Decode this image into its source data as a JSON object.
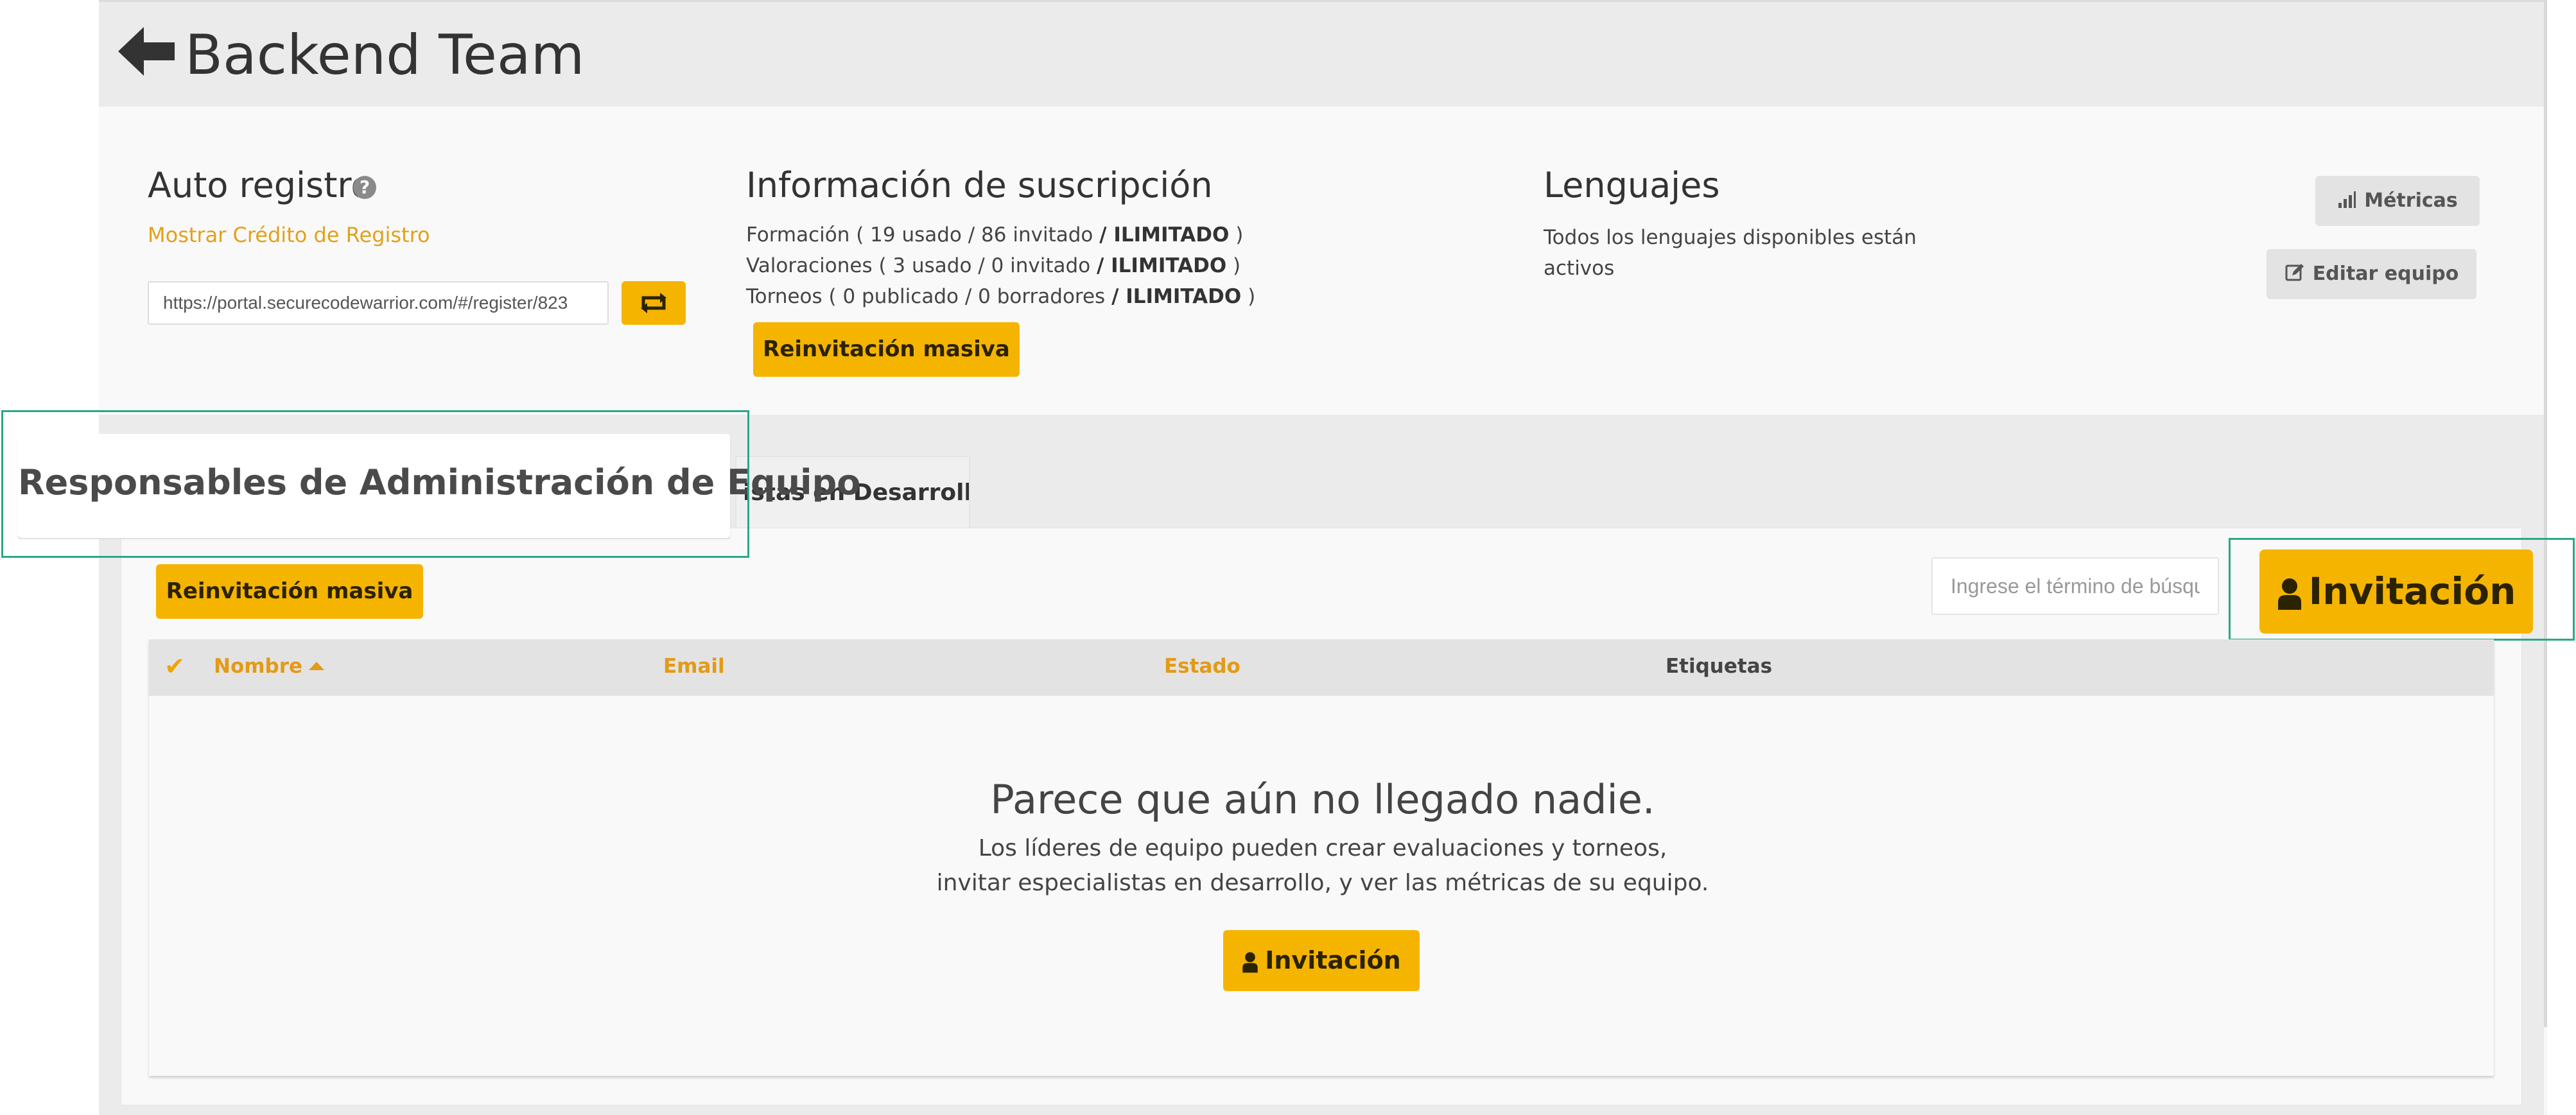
{
  "header": {
    "title": "Backend Team"
  },
  "auto_register": {
    "title": "Auto registro",
    "help": "?",
    "show_credit_link": "Mostrar Crédito de Registro",
    "register_url": "https://portal.securecodewarrior.com/#/register/823"
  },
  "subscription": {
    "title": "Información de suscripción",
    "training_prefix": "Formación ( 19 usado / 86 invitado ",
    "assessments_prefix": "Valoraciones ( 3 usado / 0 invitado ",
    "tournaments_prefix": "Torneos ( 0 publicado / 0 borradores ",
    "unlimited": "/ ILIMITADO",
    "close_paren": " )",
    "mass_reinvite_label": "Reinvitación masiva"
  },
  "languages": {
    "title": "Lenguajes",
    "text": "Todos los lenguajes disponibles están activos"
  },
  "actions": {
    "metrics_label": "Métricas",
    "edit_team_label": "Editar equipo"
  },
  "tabs": [
    {
      "label": "Responsables de Administración de Equipo",
      "active": true
    },
    {
      "label": "istas en Desarrollo",
      "active": false
    }
  ],
  "panel": {
    "mass_reinvite_label": "Reinvitación masiva",
    "search_placeholder": "Ingrese el término de búsqueda",
    "invite_label": "Invitación"
  },
  "table": {
    "columns": [
      "Nombre",
      "Email",
      "Estado",
      "Etiquetas"
    ],
    "sorted_column": "Nombre",
    "sort_direction": "ascending"
  },
  "empty_state": {
    "title": "Parece que aún no llegado nadie.",
    "line1": "Los líderes de equipo pueden crear evaluaciones y torneos,",
    "line2": "invitar especialistas en desarrollo, y ver las métricas de su equipo.",
    "invite_label": "Invitación"
  },
  "colors": {
    "accent": "#f5b400",
    "link": "#e2a11a",
    "highlight_border": "#2aa887"
  },
  "icons": [
    "arrow-left-icon",
    "help-icon",
    "refresh-icon",
    "bar-chart-icon",
    "edit-icon",
    "check-icon",
    "sort-caret-up-icon",
    "user-icon"
  ]
}
